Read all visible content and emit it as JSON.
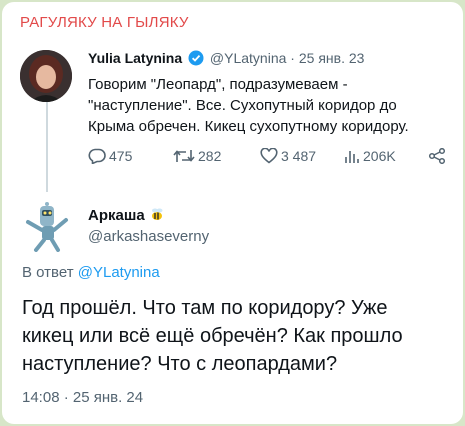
{
  "channel_title": "РАГУЛЯКУ НА ГЫЛЯКУ",
  "quoted": {
    "name": "Yulia Latynina",
    "handle": "@YLatynina",
    "separator": "·",
    "date": "25 янв. 23",
    "lines": [
      "Говорим \"Леопард\", подразумеваем -",
      "\"наступление\".  Все. Сухопутный коридор до",
      "Крыма обречен. Кикец сухопутному коридору."
    ],
    "stats": {
      "replies": "475",
      "retweets": "282",
      "likes": "3 487",
      "views": "206K"
    },
    "icons": {
      "verified": "verified-badge-icon",
      "reply": "reply-icon",
      "retweet": "retweet-icon",
      "like": "heart-icon",
      "views": "views-icon",
      "share": "share-icon"
    }
  },
  "reply": {
    "name": "Аркаша",
    "handle": "@arkashaseverny",
    "reply_to_prefix": "В ответ",
    "reply_to_handle": "@YLatynina",
    "lines": [
      "Год прошёл. Что там по коридору? Уже",
      "кикец или всё ещё обречён? Как прошло",
      "наступление? Что с леопардами?"
    ],
    "timestamp": "14:08 · 25 янв. 24"
  },
  "colors": {
    "channel": "#e24a4a",
    "link": "#1d9bf0",
    "muted": "#536471",
    "text": "#0f1419",
    "background": "#d7e6c8"
  }
}
